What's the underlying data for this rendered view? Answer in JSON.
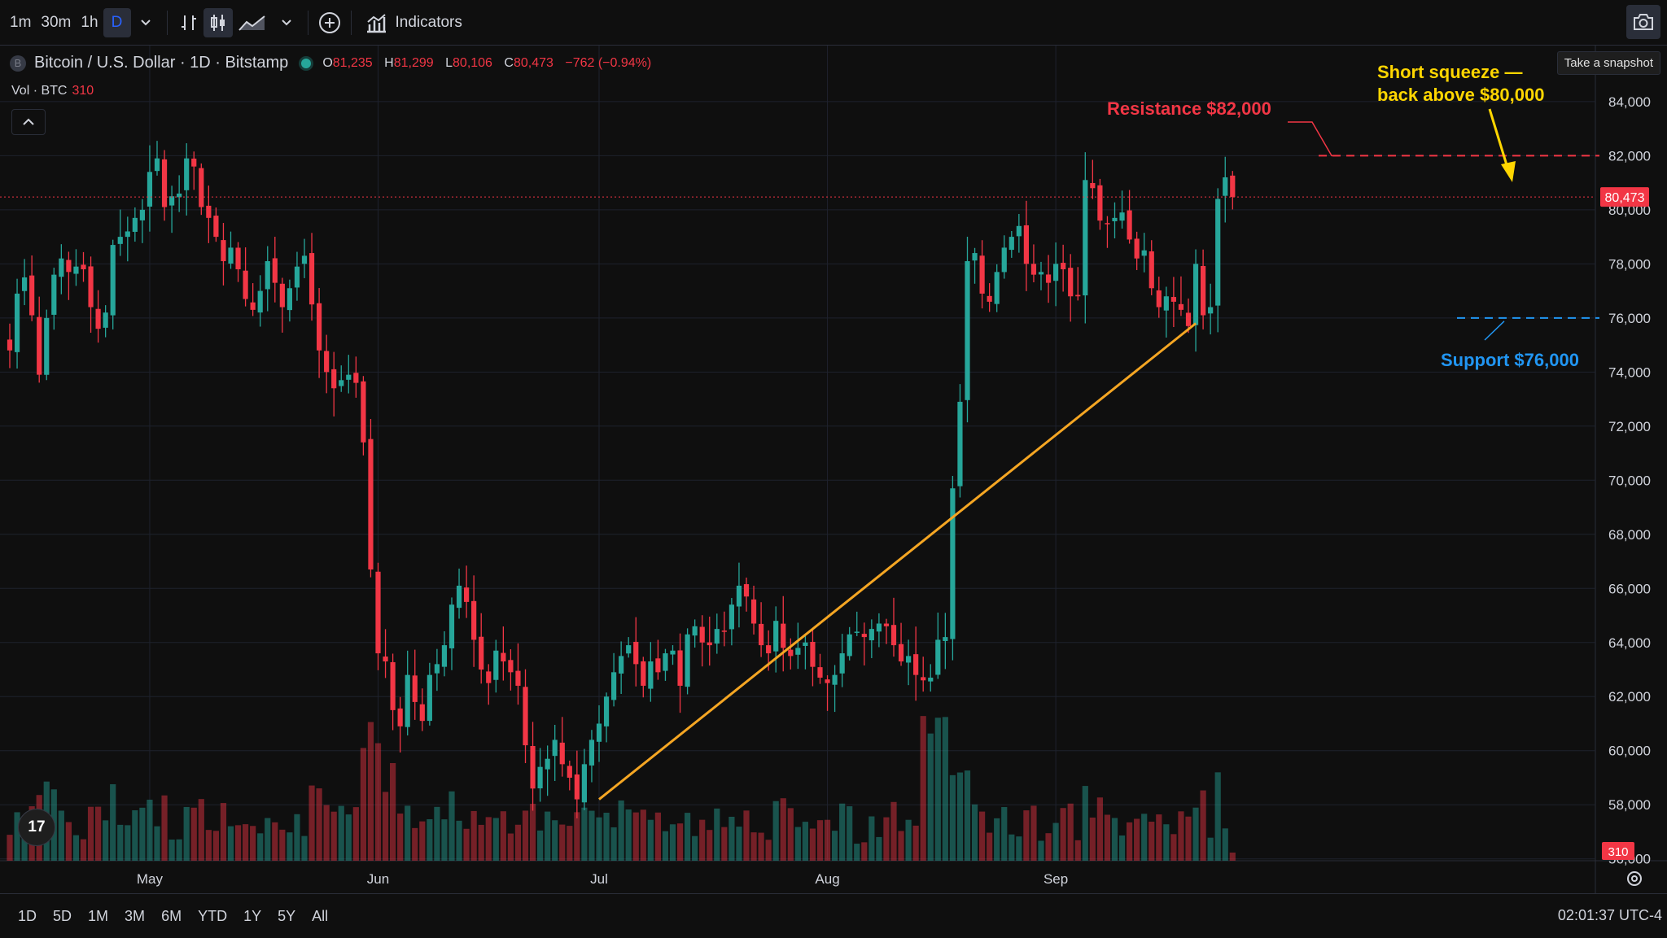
{
  "toolbar": {
    "intervals": [
      "1m",
      "30m",
      "1h",
      "D"
    ],
    "active_interval": "D",
    "indicators_label": "Indicators",
    "snapshot_tooltip": "Take a snapshot"
  },
  "legend": {
    "symbol_icon_letter": "B",
    "symbol": "Bitcoin / U.S. Dollar · 1D · Bitstamp",
    "o_label": "O",
    "o": "81,235",
    "h_label": "H",
    "h": "81,299",
    "l_label": "L",
    "l": "80,106",
    "c_label": "C",
    "c": "80,473",
    "change": "−762 (−0.94%)",
    "vol_label": "Vol · BTC",
    "vol_value": "310"
  },
  "bottom": {
    "ranges": [
      "1D",
      "5D",
      "1M",
      "3M",
      "6M",
      "YTD",
      "1Y",
      "5Y",
      "All"
    ],
    "time": "02:01:37 UTC-4"
  },
  "logo_text": "17",
  "colors": {
    "up": "#26a69a",
    "down": "#f23645",
    "trend": "#f5a623",
    "resistance": "#f23645",
    "support": "#2196f3",
    "annotation": "#ffd600",
    "background": "#0f0f0f",
    "grid": "#1e222d"
  },
  "chart_data": {
    "type": "candlestick",
    "symbol": "Bitcoin / U.S. Dollar · 1D · Bitstamp",
    "y_axis": {
      "ticks": [
        56000,
        58000,
        60000,
        62000,
        64000,
        66000,
        68000,
        70000,
        72000,
        74000,
        76000,
        78000,
        80000,
        82000,
        84000
      ],
      "tick_labels": [
        "56,000",
        "58,000",
        "60,000",
        "62,000",
        "64,000",
        "66,000",
        "68,000",
        "70,000",
        "72,000",
        "74,000",
        "76,000",
        "78,000",
        "80,000",
        "82,000",
        "84,000"
      ],
      "range": [
        55600,
        85200
      ]
    },
    "x_axis": {
      "labels": [
        {
          "label": "May",
          "day": 19
        },
        {
          "label": "Jun",
          "day": 50
        },
        {
          "label": "Jul",
          "day": 80
        },
        {
          "label": "Aug",
          "day": 111
        },
        {
          "label": "Sep",
          "day": 142
        }
      ]
    },
    "last_price": 80473,
    "last_price_label": "80,473",
    "last_volume": 310,
    "last_volume_label": "310",
    "close": [
      74800,
      76900,
      77500,
      76100,
      73900,
      76000,
      77600,
      78200,
      77700,
      77900,
      77800,
      76400,
      75600,
      76200,
      78700,
      79000,
      79200,
      79700,
      80000,
      81400,
      81900,
      80100,
      80500,
      80600,
      81900,
      81600,
      80100,
      79700,
      79000,
      78100,
      78600,
      77800,
      76700,
      76300,
      77000,
      78100,
      77300,
      76400,
      77100,
      77900,
      78300,
      76500,
      74800,
      74000,
      73400,
      73700,
      73900,
      73600,
      71400,
      66700,
      63600,
      63300,
      61500,
      60900,
      62800,
      61800,
      61100,
      62800,
      63200,
      63900,
      65400,
      66100,
      65500,
      64100,
      63000,
      62500,
      63700,
      63300,
      62900,
      62400,
      60200,
      58600,
      59400,
      59700,
      60400,
      59500,
      59000,
      58200,
      59500,
      60400,
      61000,
      62000,
      62900,
      63500,
      63900,
      63200,
      62400,
      63300,
      62900,
      63600,
      63700,
      62400,
      64300,
      64600,
      64000,
      63900,
      64500,
      64400,
      65400,
      66100,
      65700,
      64700,
      63900,
      63600,
      64800,
      63800,
      63500,
      63800,
      64000,
      63100,
      62700,
      62500,
      62800,
      63600,
      64300,
      64400,
      64200,
      64500,
      64700,
      64600,
      63900,
      63300,
      63500,
      62800,
      62600,
      62700,
      64100,
      64200,
      69700,
      72900,
      78100,
      78400,
      76900,
      76600,
      77700,
      78600,
      79000,
      79400,
      78000,
      77600,
      77700,
      77300,
      78000,
      77800,
      76800,
      76800,
      81100,
      80800,
      79600,
      79500,
      79700,
      79900,
      78900,
      78200,
      78500,
      77100,
      76400,
      76800,
      76600,
      76300,
      75700,
      78000,
      76100,
      76400,
      80400,
      81200,
      80473
    ],
    "annotations": [
      {
        "type": "hline",
        "value": 82000,
        "style": "dashed",
        "color": "#f23645",
        "label": "Resistance $82,000"
      },
      {
        "type": "hline",
        "value": 76000,
        "style": "dashed",
        "color": "#2196f3",
        "label": "Support $76,000"
      },
      {
        "type": "trendline",
        "from": {
          "day": 80,
          "price": 58200
        },
        "to": {
          "day": 161,
          "price": 75800
        },
        "color": "#f5a623"
      },
      {
        "type": "text",
        "lines": [
          "Short squeeze —",
          "back above $80,000"
        ],
        "color": "#ffd600"
      }
    ]
  }
}
